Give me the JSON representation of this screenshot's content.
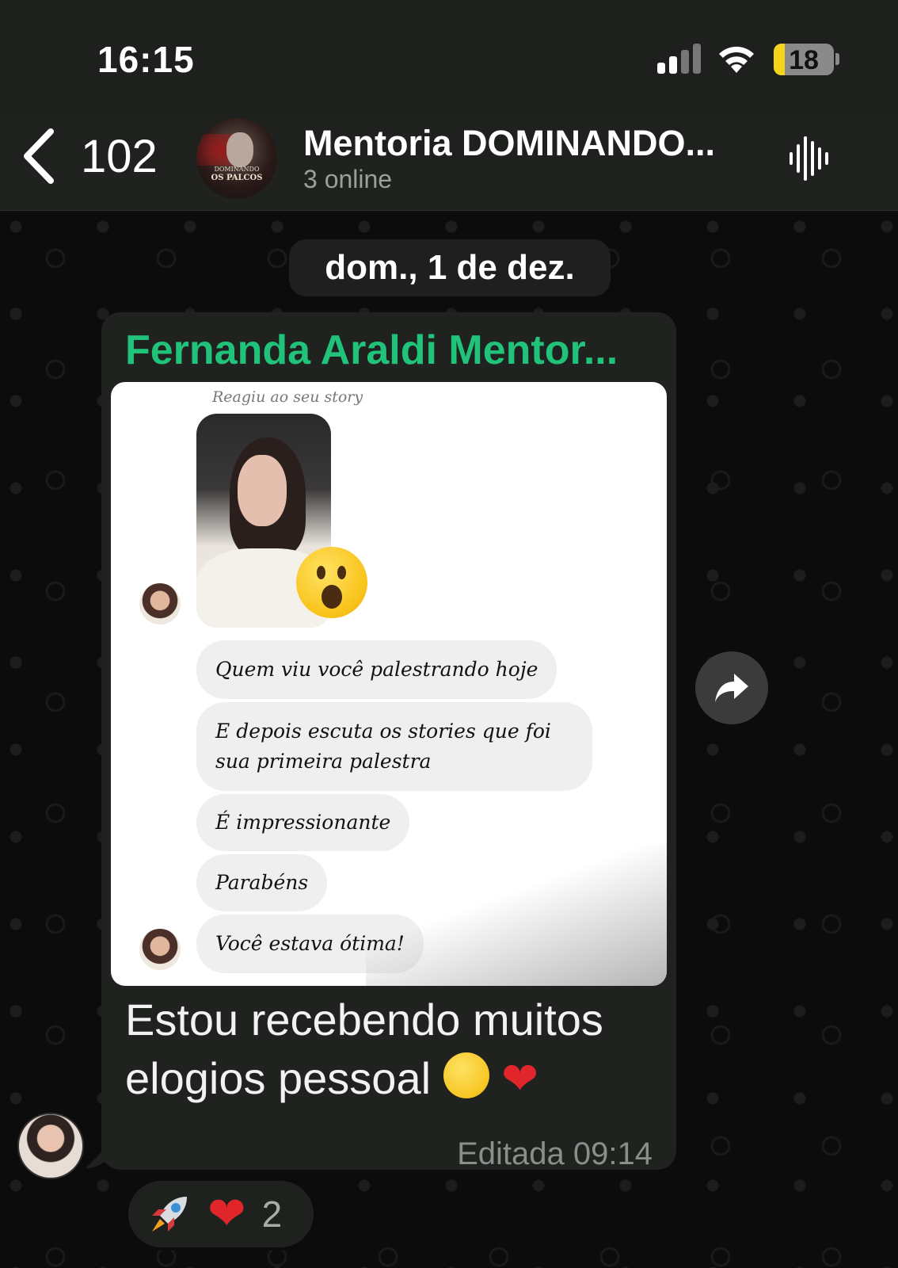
{
  "status_bar": {
    "time": "16:15",
    "battery": "18",
    "battery_color": "#f6d41c"
  },
  "header": {
    "back_count": "102",
    "group_name": "Mentoria DOMINANDO...",
    "group_status": "3 online",
    "avatar_text_top": "DOMINANDO",
    "avatar_text_bottom": "OS PALCOS",
    "icons": [
      "chevron-left-icon",
      "audio-waveform-icon"
    ]
  },
  "chat": {
    "date_label": "dom., 1 de dez.",
    "message": {
      "sender": "Fernanda Araldi Mentor...",
      "sender_color": "#21c27a",
      "attachment": {
        "caption": "Reagiu ao seu story",
        "dm_messages": [
          "Quem viu você palestrando hoje",
          "E depois escuta os stories que foi sua primeira palestra",
          "É impressionante",
          "Parabéns",
          "Você estava ótima!"
        ]
      },
      "text": "Estou recebendo muitos elogios pessoal",
      "edited_label": "Editada",
      "time": "09:14"
    },
    "reactions": {
      "emojis": [
        "rocket",
        "heart"
      ],
      "count": "2"
    }
  }
}
